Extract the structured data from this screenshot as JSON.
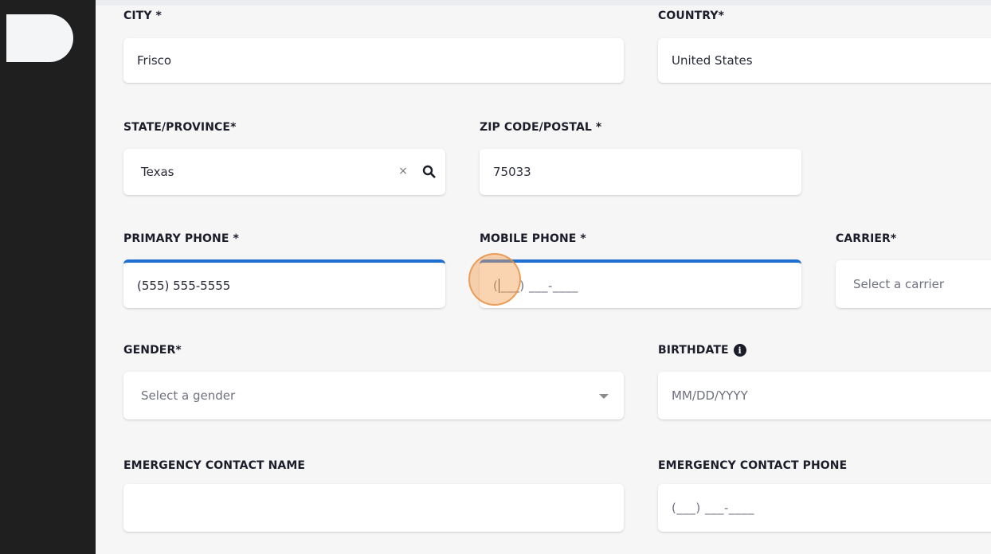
{
  "form": {
    "city": {
      "label": "CITY *",
      "value": "Frisco"
    },
    "country": {
      "label": "COUNTRY*",
      "value": "United States"
    },
    "state": {
      "label": "STATE/PROVINCE*",
      "value": "Texas"
    },
    "zip": {
      "label": "ZIP CODE/POSTAL *",
      "value": "75033"
    },
    "primary_phone": {
      "label": "PRIMARY PHONE *",
      "value": "(555) 555-5555"
    },
    "mobile_phone": {
      "label": "MOBILE PHONE *",
      "mask_open": "(",
      "mask_rest": "___) ___-____"
    },
    "carrier": {
      "label": "CARRIER*",
      "placeholder": "Select a carrier"
    },
    "gender": {
      "label": "GENDER*",
      "placeholder": "Select a gender"
    },
    "birthdate": {
      "label": "BIRTHDATE",
      "placeholder": "MM/DD/YYYY"
    },
    "emergency_name": {
      "label": "EMERGENCY CONTACT NAME",
      "value": ""
    },
    "emergency_phone": {
      "label": "EMERGENCY CONTACT PHONE",
      "mask": "(___) ___-____"
    }
  },
  "icons": {
    "clear": "×",
    "search": "search-icon",
    "info": "i",
    "caret": "chevron-down-icon"
  },
  "colors": {
    "focus_border": "#1f6fd0",
    "sidebar": "#1f1f1f",
    "cursor_highlight": "#f5a050"
  }
}
